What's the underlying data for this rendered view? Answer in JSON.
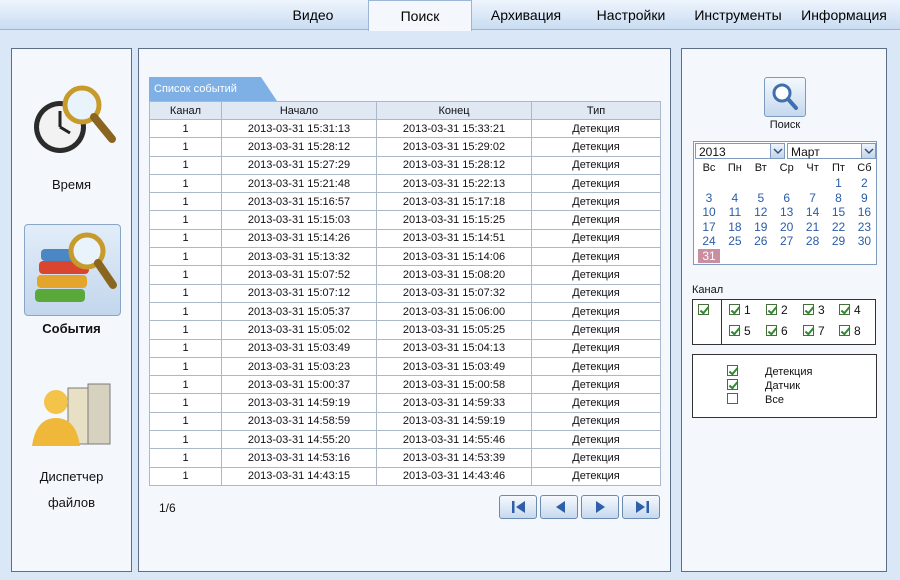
{
  "tabs": [
    "Видео",
    "Поиск",
    "Архивация",
    "Настройки",
    "Инструменты",
    "Информация"
  ],
  "active_tab": "Поиск",
  "left_nav": [
    {
      "label": "Время"
    },
    {
      "label": "События"
    },
    {
      "label": "Диспетчер",
      "label2": "файлов"
    }
  ],
  "events": {
    "tab_label": "Список событий",
    "columns": [
      "Канал",
      "Начало",
      "Конец",
      "Тип"
    ],
    "rows": [
      [
        "1",
        "2013-03-31 15:31:13",
        "2013-03-31 15:33:21",
        "Детекция"
      ],
      [
        "1",
        "2013-03-31 15:28:12",
        "2013-03-31 15:29:02",
        "Детекция"
      ],
      [
        "1",
        "2013-03-31 15:27:29",
        "2013-03-31 15:28:12",
        "Детекция"
      ],
      [
        "1",
        "2013-03-31 15:21:48",
        "2013-03-31 15:22:13",
        "Детекция"
      ],
      [
        "1",
        "2013-03-31 15:16:57",
        "2013-03-31 15:17:18",
        "Детекция"
      ],
      [
        "1",
        "2013-03-31 15:15:03",
        "2013-03-31 15:15:25",
        "Детекция"
      ],
      [
        "1",
        "2013-03-31 15:14:26",
        "2013-03-31 15:14:51",
        "Детекция"
      ],
      [
        "1",
        "2013-03-31 15:13:32",
        "2013-03-31 15:14:06",
        "Детекция"
      ],
      [
        "1",
        "2013-03-31 15:07:52",
        "2013-03-31 15:08:20",
        "Детекция"
      ],
      [
        "1",
        "2013-03-31 15:07:12",
        "2013-03-31 15:07:32",
        "Детекция"
      ],
      [
        "1",
        "2013-03-31 15:05:37",
        "2013-03-31 15:06:00",
        "Детекция"
      ],
      [
        "1",
        "2013-03-31 15:05:02",
        "2013-03-31 15:05:25",
        "Детекция"
      ],
      [
        "1",
        "2013-03-31 15:03:49",
        "2013-03-31 15:04:13",
        "Детекция"
      ],
      [
        "1",
        "2013-03-31 15:03:23",
        "2013-03-31 15:03:49",
        "Детекция"
      ],
      [
        "1",
        "2013-03-31 15:00:37",
        "2013-03-31 15:00:58",
        "Детекция"
      ],
      [
        "1",
        "2013-03-31 14:59:19",
        "2013-03-31 14:59:33",
        "Детекция"
      ],
      [
        "1",
        "2013-03-31 14:58:59",
        "2013-03-31 14:59:19",
        "Детекция"
      ],
      [
        "1",
        "2013-03-31 14:55:20",
        "2013-03-31 14:55:46",
        "Детекция"
      ],
      [
        "1",
        "2013-03-31 14:53:16",
        "2013-03-31 14:53:39",
        "Детекция"
      ],
      [
        "1",
        "2013-03-31 14:43:15",
        "2013-03-31 14:43:46",
        "Детекция"
      ]
    ],
    "page_info": "1/6"
  },
  "search": {
    "label": "Поиск",
    "year": "2013",
    "month": "Март",
    "weekdays": [
      "Вс",
      "Пн",
      "Вт",
      "Ср",
      "Чт",
      "Пт",
      "Сб"
    ],
    "days": [
      "1",
      "2",
      "3",
      "4",
      "5",
      "6",
      "7",
      "8",
      "9",
      "10",
      "11",
      "12",
      "13",
      "14",
      "15",
      "16",
      "17",
      "18",
      "19",
      "20",
      "21",
      "22",
      "23",
      "24",
      "25",
      "26",
      "27",
      "28",
      "29",
      "30",
      "31"
    ],
    "selected_day": "31",
    "channel_label": "Канал",
    "channels": [
      {
        "label": "",
        "checked": true
      },
      {
        "label": "1",
        "checked": true
      },
      {
        "label": "2",
        "checked": true
      },
      {
        "label": "3",
        "checked": true
      },
      {
        "label": "4",
        "checked": true
      },
      {
        "label": "5",
        "checked": true
      },
      {
        "label": "6",
        "checked": true
      },
      {
        "label": "7",
        "checked": true
      },
      {
        "label": "8",
        "checked": true
      }
    ],
    "event_types": [
      {
        "label": "Детекция",
        "checked": true
      },
      {
        "label": "Датчик",
        "checked": true
      },
      {
        "label": "Все",
        "checked": false
      }
    ]
  },
  "colors": {
    "accent": "#5b9bdc",
    "today": "#c98fa0",
    "day_text": "#2a5ca8"
  }
}
